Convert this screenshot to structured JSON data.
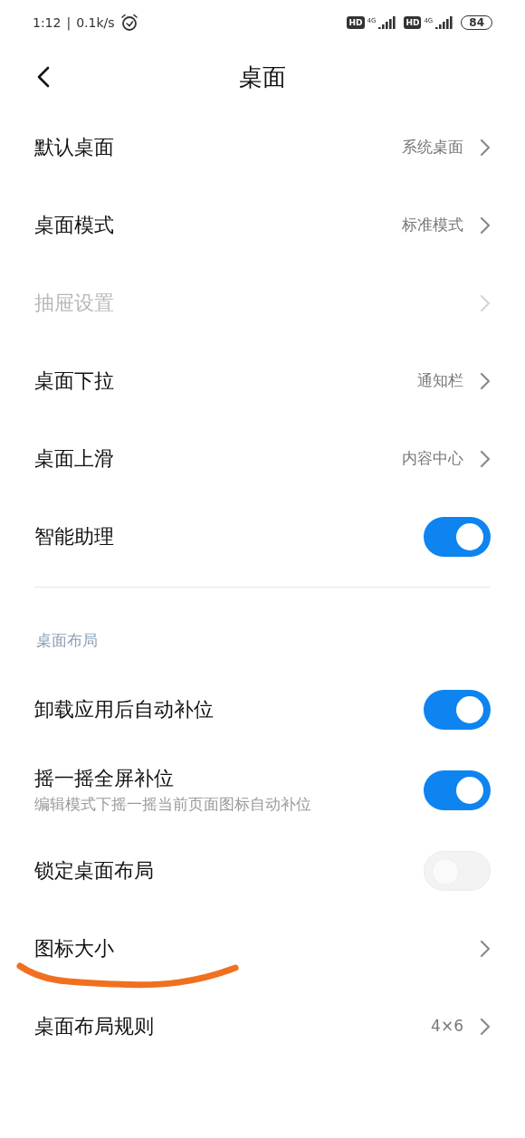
{
  "status_bar": {
    "time": "1:12",
    "separator": "|",
    "speed": "0.1k/s",
    "sims": [
      {
        "badge": "HD",
        "network": "4G"
      },
      {
        "badge": "HD",
        "network": "4G"
      }
    ],
    "battery": "84"
  },
  "header": {
    "title": "桌面"
  },
  "groups": [
    {
      "items": [
        {
          "kind": "nav",
          "label": "默认桌面",
          "value": "系统桌面",
          "disabled": false
        },
        {
          "kind": "nav",
          "label": "桌面模式",
          "value": "标准模式",
          "disabled": false
        },
        {
          "kind": "nav",
          "label": "抽屉设置",
          "disabled": true
        },
        {
          "kind": "nav",
          "label": "桌面下拉",
          "value": "通知栏",
          "disabled": false
        },
        {
          "kind": "nav",
          "label": "桌面上滑",
          "value": "内容中心",
          "disabled": false
        },
        {
          "kind": "toggle",
          "label": "智能助理",
          "on": true,
          "disabled": false
        }
      ]
    },
    {
      "title": "桌面布局",
      "items": [
        {
          "kind": "toggle",
          "label": "卸载应用后自动补位",
          "on": true,
          "disabled": false
        },
        {
          "kind": "toggle",
          "label": "摇一摇全屏补位",
          "subtitle": "编辑模式下摇一摇当前页面图标自动补位",
          "on": true,
          "disabled": false
        },
        {
          "kind": "toggle",
          "label": "锁定桌面布局",
          "on": false,
          "disabled": true
        },
        {
          "kind": "nav",
          "label": "图标大小",
          "disabled": false,
          "annotated": true
        },
        {
          "kind": "nav",
          "label": "桌面布局规则",
          "value": "4×6",
          "disabled": false
        }
      ]
    }
  ]
}
